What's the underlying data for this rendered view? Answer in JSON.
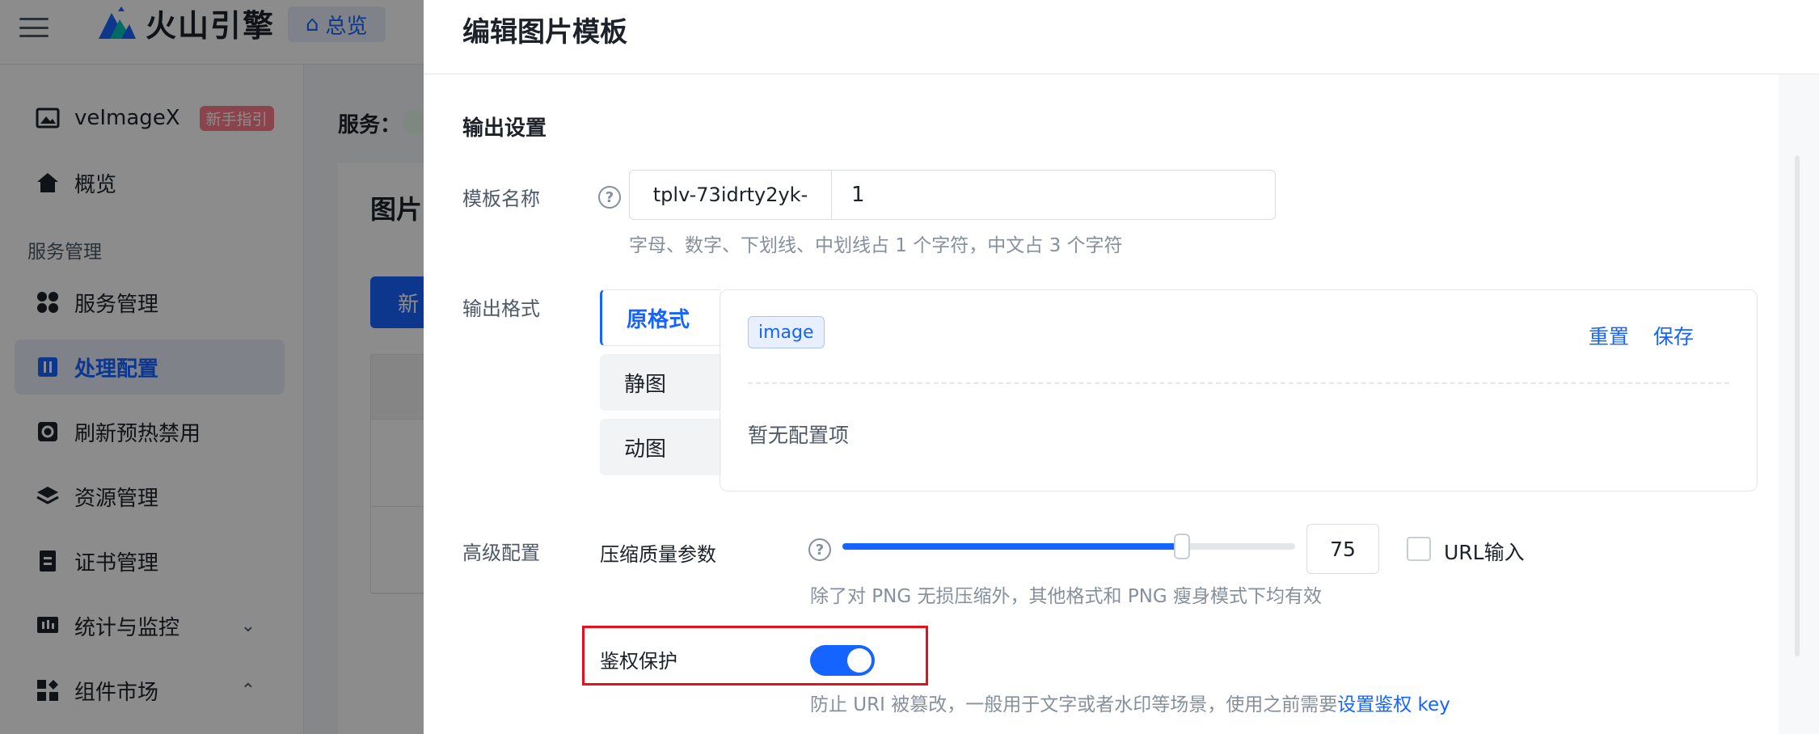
{
  "topbar": {
    "brand": "火山引擎",
    "nav_home": "总览"
  },
  "sidebar": {
    "product": {
      "label": "veImageX",
      "badge": "新手指引"
    },
    "overview": "概览",
    "group_label": "服务管理",
    "items": [
      {
        "label": "服务管理"
      },
      {
        "label": "处理配置",
        "active": true
      },
      {
        "label": "刷新预热禁用"
      },
      {
        "label": "资源管理"
      },
      {
        "label": "证书管理"
      },
      {
        "label": "统计与监控",
        "chevron": "down"
      },
      {
        "label": "组件市场",
        "chevron": "up"
      }
    ]
  },
  "background": {
    "service_label": "服务：",
    "card_title": "图片",
    "new_button": "新"
  },
  "drawer": {
    "title": "编辑图片模板",
    "section_output": "输出设置",
    "template_name": {
      "label": "模板名称",
      "prefix": "tplv-73idrty2yk-",
      "value": "1",
      "hint": "字母、数字、下划线、中划线占 1 个字符，中文占 3 个字符"
    },
    "output_format": {
      "label": "输出格式",
      "tabs": [
        "原格式",
        "静图",
        "动图"
      ],
      "active_tab": 0,
      "panel": {
        "tag": "image",
        "reset": "重置",
        "save": "保存",
        "empty": "暂无配置项"
      }
    },
    "advanced": {
      "label": "高级配置",
      "quality": {
        "label": "压缩质量参数",
        "value": 75,
        "value_text": "75",
        "max": 100,
        "url_input_label": "URL输入",
        "url_input_checked": false,
        "hint": "除了对 PNG 无损压缩外，其他格式和 PNG 瘦身模式下均有效"
      },
      "auth": {
        "label": "鉴权保护",
        "enabled": true,
        "hint_prefix": "防止 URI 被篡改，一般用于文字或者水印等场景，使用之前需要",
        "hint_link": "设置鉴权 key"
      }
    }
  },
  "colors": {
    "primary": "#1664ff",
    "highlight": "#e8101a"
  }
}
